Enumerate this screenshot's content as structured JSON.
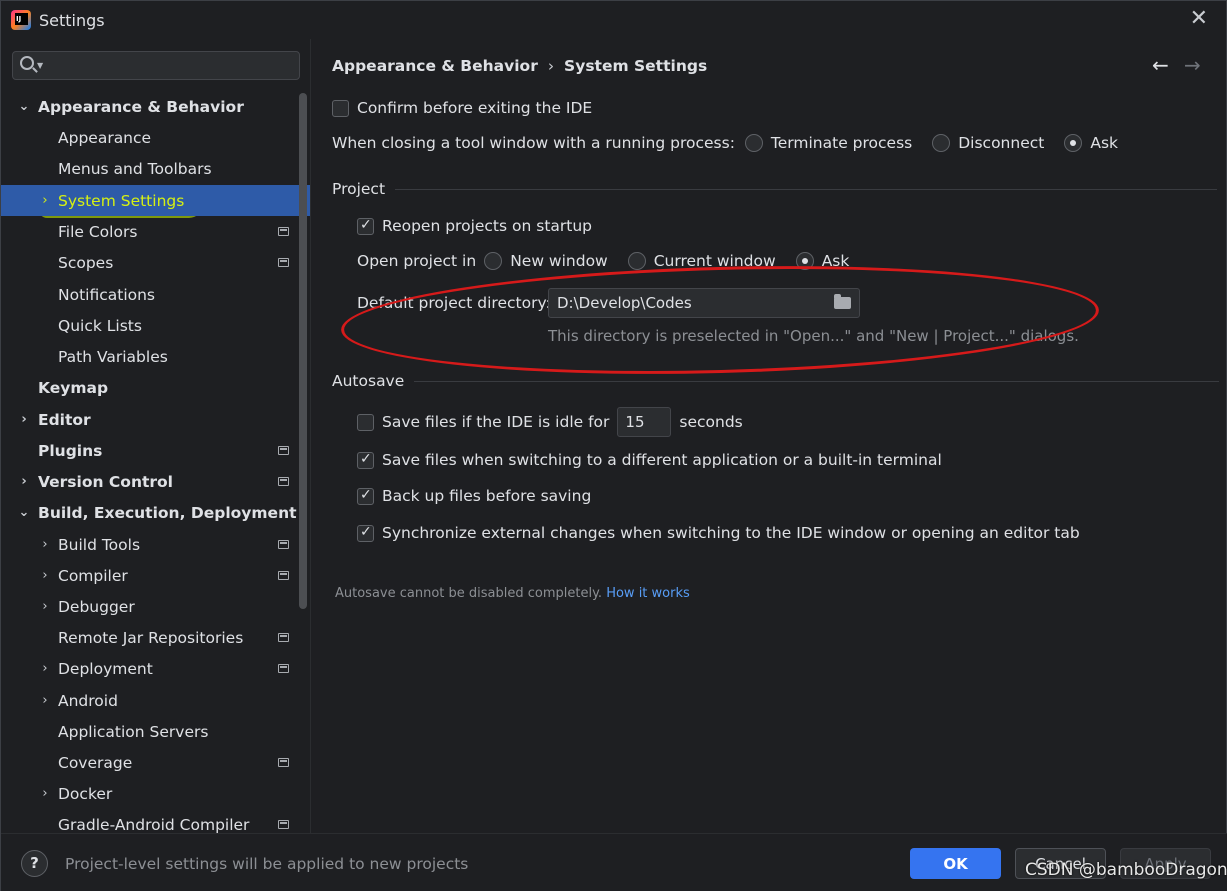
{
  "window": {
    "title": "Settings",
    "close_label": "✕"
  },
  "sidebar": {
    "search_placeholder": "",
    "items": [
      {
        "label": "Appearance & Behavior",
        "bold": true,
        "expanded": true
      },
      {
        "label": "Appearance"
      },
      {
        "label": "Menus and Toolbars"
      },
      {
        "label": "System Settings",
        "selected": true
      },
      {
        "label": "File Colors"
      },
      {
        "label": "Scopes"
      },
      {
        "label": "Notifications"
      },
      {
        "label": "Quick Lists"
      },
      {
        "label": "Path Variables"
      },
      {
        "label": "Keymap",
        "bold": true
      },
      {
        "label": "Editor",
        "bold": true
      },
      {
        "label": "Plugins",
        "bold": true
      },
      {
        "label": "Version Control",
        "bold": true
      },
      {
        "label": "Build, Execution, Deployment",
        "bold": true,
        "expanded": true
      },
      {
        "label": "Build Tools"
      },
      {
        "label": "Compiler"
      },
      {
        "label": "Debugger"
      },
      {
        "label": "Remote Jar Repositories"
      },
      {
        "label": "Deployment"
      },
      {
        "label": "Android"
      },
      {
        "label": "Application Servers"
      },
      {
        "label": "Coverage"
      },
      {
        "label": "Docker"
      },
      {
        "label": "Gradle-Android Compiler"
      }
    ]
  },
  "breadcrumb": {
    "parent": "Appearance & Behavior",
    "separator": "›",
    "current": "System Settings"
  },
  "nav": {
    "back": "←",
    "forward": "→"
  },
  "general": {
    "confirm_exit": "Confirm before exiting the IDE",
    "closing_label": "When closing a tool window with a running process:",
    "closing_options": [
      "Terminate process",
      "Disconnect",
      "Ask"
    ]
  },
  "project": {
    "header": "Project",
    "reopen": "Reopen projects on startup",
    "open_in_label": "Open project in",
    "open_in_options": [
      "New window",
      "Current window",
      "Ask"
    ],
    "default_dir_label": "Default project directory:",
    "default_dir_value": "D:\\Develop\\Codes",
    "default_dir_hint": "This directory is preselected in \"Open...\" and \"New | Project...\" dialogs."
  },
  "autosave": {
    "header": "Autosave",
    "idle_label": "Save files if the IDE is idle for",
    "idle_value": "15",
    "idle_unit": "seconds",
    "switching": "Save files when switching to a different application or a built-in terminal",
    "backup": "Back up files before saving",
    "sync": "Synchronize external changes when switching to the IDE window or opening an editor tab",
    "note": "Autosave cannot be disabled completely.",
    "note_link": "How it works"
  },
  "footer": {
    "help": "?",
    "message": "Project-level settings will be applied to new projects",
    "ok": "OK",
    "cancel": "Cancel",
    "apply": "Apply"
  },
  "watermark": "CSDN @bambooDragon",
  "colors": {
    "accent": "#3574f0",
    "selection": "#2e5ba8",
    "link": "#589df6",
    "annotation": "#d61a1a",
    "highlighter": "#8aa60a"
  }
}
